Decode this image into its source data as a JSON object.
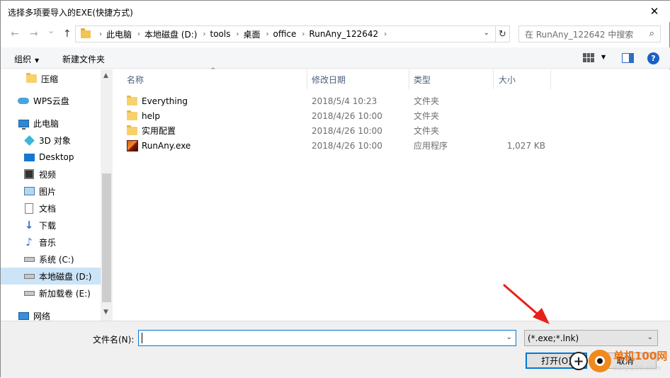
{
  "window": {
    "title": "选择多项要导入的EXE(快捷方式)",
    "close_glyph": "✕"
  },
  "address": {
    "back_glyph": "←",
    "forward_glyph": "→",
    "recent_glyph": "⌄",
    "up_glyph": "↑",
    "crumbs": [
      "此电脑",
      "本地磁盘 (D:)",
      "tools",
      "桌面",
      "office",
      "RunAny_122642"
    ],
    "dropdown_glyph": "⌄",
    "refresh_glyph": "↻",
    "search_placeholder": "在 RunAny_122642 中搜索",
    "search_icon": "search-icon"
  },
  "toolbar": {
    "organize_label": "组织",
    "new_folder_label": "新建文件夹"
  },
  "sidebar": {
    "items": [
      {
        "label": "压缩",
        "icon": "folder-icon"
      },
      {
        "label": "WPS云盘",
        "icon": "cloud-icon"
      },
      {
        "label": "此电脑",
        "icon": "computer-icon"
      },
      {
        "label": "3D 对象",
        "icon": "cube-icon"
      },
      {
        "label": "Desktop",
        "icon": "desktop-icon"
      },
      {
        "label": "视频",
        "icon": "video-icon"
      },
      {
        "label": "图片",
        "icon": "picture-icon"
      },
      {
        "label": "文档",
        "icon": "document-icon"
      },
      {
        "label": "下载",
        "icon": "download-icon"
      },
      {
        "label": "音乐",
        "icon": "music-icon"
      },
      {
        "label": "系统 (C:)",
        "icon": "windows-drive-icon"
      },
      {
        "label": "本地磁盘 (D:)",
        "icon": "drive-icon",
        "selected": true
      },
      {
        "label": "新加载卷 (E:)",
        "icon": "drive-icon"
      },
      {
        "label": "网络",
        "icon": "network-icon"
      }
    ]
  },
  "filelist": {
    "columns": {
      "name": "名称",
      "date": "修改日期",
      "type": "类型",
      "size": "大小"
    },
    "rows": [
      {
        "name": "Everything",
        "date": "2018/5/4 10:23",
        "type": "文件夹",
        "size": "",
        "icon": "folder-icon"
      },
      {
        "name": "help",
        "date": "2018/4/26 10:00",
        "type": "文件夹",
        "size": "",
        "icon": "folder-icon"
      },
      {
        "name": "实用配置",
        "date": "2018/4/26 10:00",
        "type": "文件夹",
        "size": "",
        "icon": "folder-icon"
      },
      {
        "name": "RunAny.exe",
        "date": "2018/4/26 10:00",
        "type": "应用程序",
        "size": "1,027 KB",
        "icon": "exe-icon"
      }
    ]
  },
  "bottom": {
    "filename_label": "文件名(N):",
    "filename_value": "",
    "filetype_value": "(*.exe;*.lnk)",
    "open_label": "打开(O)",
    "cancel_label": "取消"
  },
  "watermark": {
    "site_name": "单机100网",
    "site_url": "danji100.com"
  },
  "colors": {
    "accent": "#0078d7",
    "selection": "#cce4f7",
    "annotation_arrow": "#e8201a",
    "watermark_orange": "#f08a1c"
  }
}
